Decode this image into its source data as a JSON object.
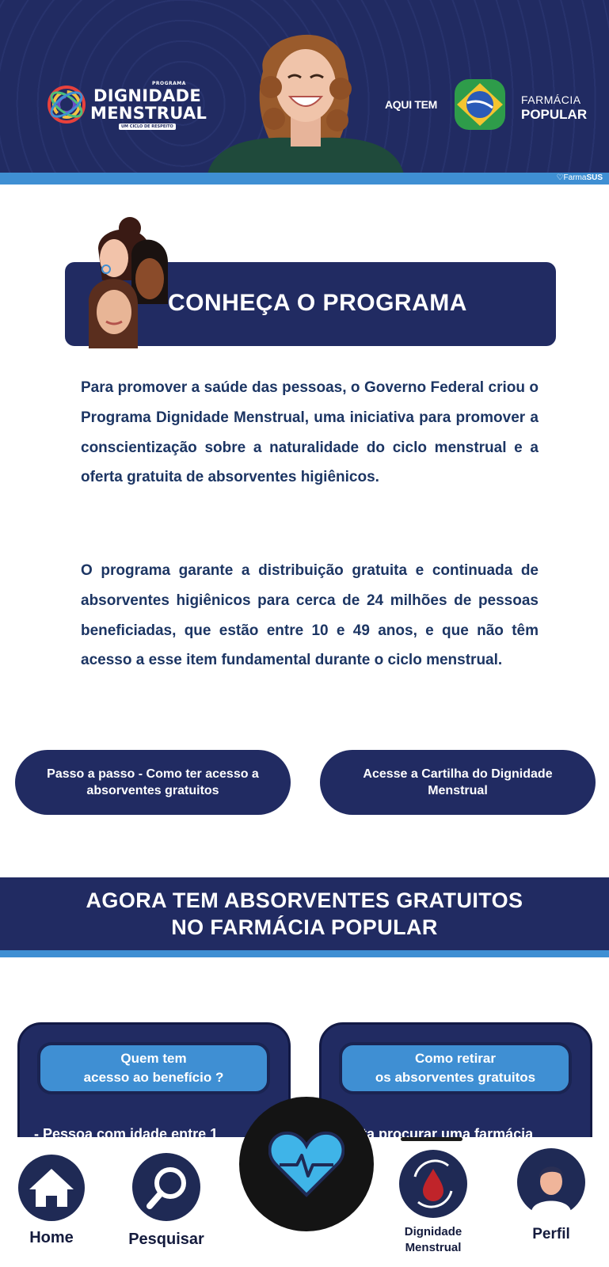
{
  "banner": {
    "program_small": "PROGRAMA",
    "program_line1": "DIGNIDADE",
    "program_line2": "MENSTRUAL",
    "program_tagline": "UM CICLO DE RESPEITO",
    "aqui_tem": "AQUI TEM",
    "farmacia": "FARMÁCIA",
    "popular": "POPULAR",
    "farma_sus_prefix": "Farma",
    "farma_sus_suffix": "SUS"
  },
  "program_section": {
    "title": "CONHEÇA O PROGRAMA",
    "paragraph1": "Para promover a saúde das pessoas, o Governo Federal criou o Programa Dignidade Menstrual, uma iniciativa para promover a conscientização sobre a naturalidade do ciclo menstrual e a oferta gratuita de absorventes higiênicos.",
    "paragraph2": "O programa garante a distribuição gratuita e continuada de absorventes higiênicos para cerca de 24 milhões de pessoas beneficiadas, que estão entre 10 e 49 anos, e que não têm acesso a esse item fundamental durante o ciclo menstrual."
  },
  "buttons": {
    "step_by_step": "Passo a passo - Como ter acesso a absorventes gratuitos",
    "booklet": "Acesse a Cartilha do Dignidade Menstrual"
  },
  "section_banner": {
    "line1": "AGORA TEM ABSORVENTES GRATUITOS",
    "line2": "NO FARMÁCIA POPULAR"
  },
  "cards": {
    "left_title_line1": "Quem tem",
    "left_title_line2": "acesso ao benefício ?",
    "left_text": "- Pessoa com idade entre 1",
    "right_title_line1": "Como retirar",
    "right_title_line2": "os absorventes gratuitos",
    "right_text": "Basta procurar uma farmácia"
  },
  "bottom_nav": {
    "home": "Home",
    "search": "Pesquisar",
    "dm_line1": "Dignidade",
    "dm_line2": "Menstrual",
    "profile": "Perfil"
  },
  "icons": {
    "home": "home-icon",
    "search": "search-icon",
    "center": "heart-pulse-icon",
    "dm": "blood-drop-cycle-icon",
    "profile": "user-avatar-icon"
  },
  "colors": {
    "navy": "#212b62",
    "accent_blue": "#3f8fd3",
    "text_navy": "#1c3563"
  }
}
